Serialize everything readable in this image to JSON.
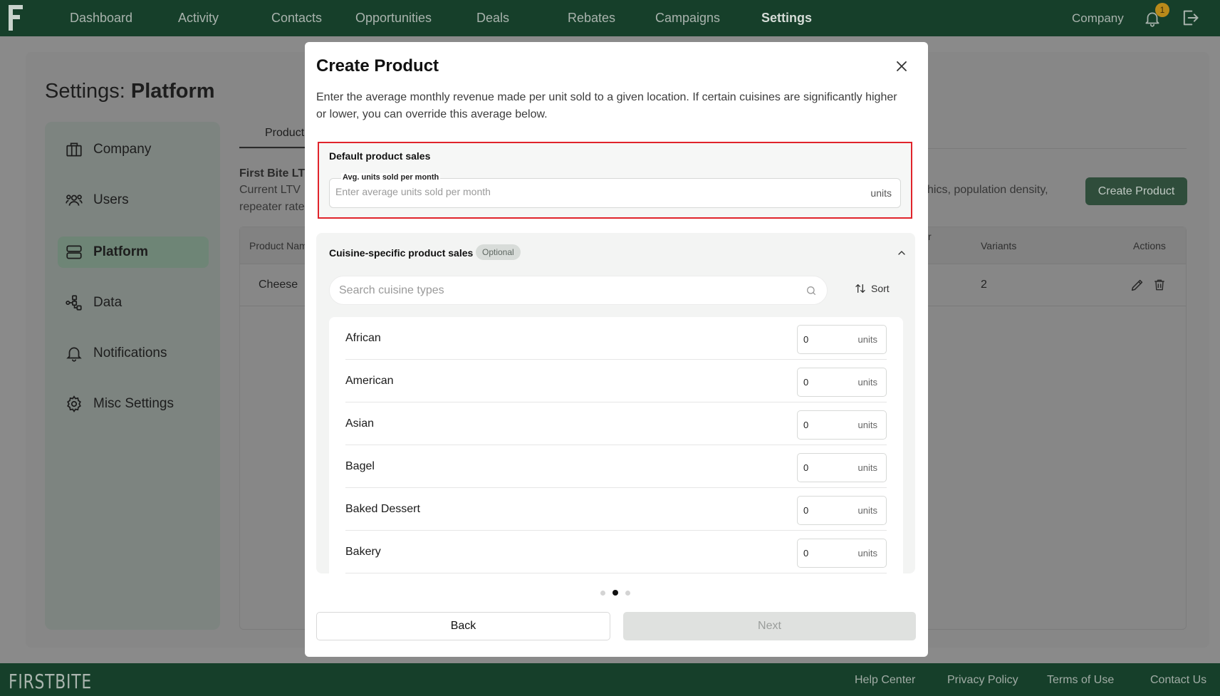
{
  "nav": {
    "links": [
      "Dashboard",
      "Activity",
      "Contacts",
      "Opportunities",
      "Deals",
      "Rebates",
      "Campaigns",
      "Settings"
    ],
    "active": "Settings",
    "company_label": "Company",
    "notification_count": "1"
  },
  "page": {
    "title_prefix": "Settings: ",
    "title_bold": "Platform",
    "sidebar": [
      {
        "label": "Company",
        "icon": "briefcase-icon"
      },
      {
        "label": "Users",
        "icon": "users-icon"
      },
      {
        "label": "Platform",
        "icon": "server-icon",
        "active": true
      },
      {
        "label": "Data",
        "icon": "data-tree-icon"
      },
      {
        "label": "Notifications",
        "icon": "bell-icon"
      },
      {
        "label": "Misc Settings",
        "icon": "gear-icon"
      }
    ],
    "tab_label": "Product",
    "ltv_title": "First Bite LTV",
    "ltv_line2": "Current LTV",
    "ltv_line3": "repeater rate",
    "right_text": "hics, population density,",
    "create_button": "Create Product",
    "table_headers": {
      "product_name": "Product Nam",
      "col_r": "r",
      "variants": "Variants",
      "actions": "Actions"
    },
    "table_row": {
      "product": "Cheese",
      "variants": "2"
    }
  },
  "modal": {
    "title": "Create Product",
    "description": "Enter the average monthly revenue made per unit sold to a given location. If certain cuisines are significantly higher or lower, you can override this average below.",
    "default_section": {
      "label": "Default product sales",
      "field_label": "Avg. units sold per month",
      "placeholder": "Enter average units sold per month",
      "unit": "units"
    },
    "cuisine_section": {
      "title": "Cuisine-specific product sales",
      "badge": "Optional",
      "search_placeholder": "Search cuisine types",
      "sort_label": "Sort",
      "unit": "units",
      "rows": [
        {
          "name": "African",
          "value": "0"
        },
        {
          "name": "American",
          "value": "0"
        },
        {
          "name": "Asian",
          "value": "0"
        },
        {
          "name": "Bagel",
          "value": "0"
        },
        {
          "name": "Baked Dessert",
          "value": "0"
        },
        {
          "name": "Bakery",
          "value": "0"
        }
      ]
    },
    "steps": {
      "total": 3,
      "current": 2
    },
    "back_label": "Back",
    "next_label": "Next"
  },
  "footer": {
    "logo": "FIRSTBITE",
    "links": [
      "Help Center",
      "Privacy Policy",
      "Terms of Use",
      "Contact Us"
    ]
  },
  "colors": {
    "nav_bg": "#163f2a",
    "highlight_border": "#e0242b",
    "primary_button": "#2f4d3b",
    "badge": "#b98a1a"
  }
}
